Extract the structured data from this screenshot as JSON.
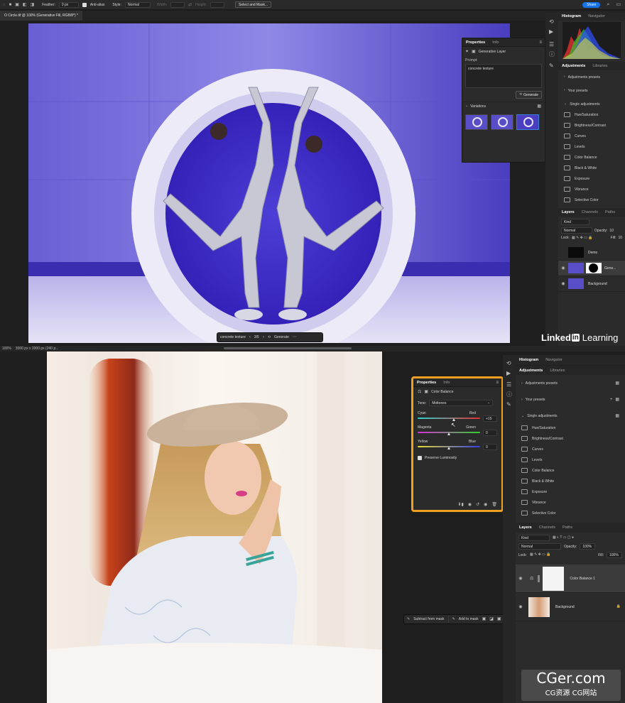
{
  "top": {
    "options_bar": {
      "feather_label": "Feather:",
      "feather_value": "0 px",
      "anti_alias_label": "Anti-alias",
      "style_label": "Style:",
      "style_value": "Normal",
      "width_label": "Width:",
      "height_label": "Height:",
      "select_mask_label": "Select and Mask...",
      "share_label": "Share"
    },
    "doc_tab": "O Circle.tif @ 100% (Generative Fill, RGB/8*) *",
    "properties": {
      "tab_properties": "Properties",
      "tab_info": "Info",
      "layer_type": "Generative Layer",
      "prompt_label": "Prompt:",
      "prompt_value": "concrete texture",
      "generate_label": "Generate",
      "variations_label": "Variations"
    },
    "canvas_bar": {
      "prompt": "concrete texture",
      "counter": "3/5",
      "generate": "Generate"
    },
    "right_panel": {
      "tab_histogram": "Histogram",
      "tab_navigator": "Navigator",
      "tab_adjustments": "Adjustments",
      "tab_libraries": "Libraries",
      "adjustment_presets": "Adjustments presets",
      "your_presets": "Your presets",
      "single_adjustments": "Single adjustments",
      "items": [
        "Hue/Saturation",
        "Brightness/Contrast",
        "Curves",
        "Levels",
        "Color Balance",
        "Black & White",
        "Exposure",
        "Vibrance",
        "Selective Color"
      ],
      "layers_tabs": [
        "Layers",
        "Channels",
        "Paths"
      ],
      "kind_label": "Kind",
      "blend_mode": "Normal",
      "opacity_label": "Opacity:",
      "opacity_value": "10",
      "lock_label": "Lock:",
      "fill_label": "Fill:",
      "fill_value": "10",
      "layers": [
        "Demo",
        "Gene...",
        "Background"
      ]
    },
    "status": "100%",
    "status_dims": "3000 px x 2000 px (240 p...",
    "watermark": "Linked",
    "watermark_in": "in",
    "watermark_learning": "Learning"
  },
  "bottom": {
    "properties": {
      "tab_properties": "Properties",
      "tab_info": "Info",
      "layer_type": "Color Balance",
      "tone_label": "Tone:",
      "tone_value": "Midtones",
      "cyan": "Cyan",
      "red": "Red",
      "cyan_red_value": "+15",
      "magenta": "Magenta",
      "green": "Green",
      "magenta_green_value": "0",
      "yellow": "Yellow",
      "blue": "Blue",
      "yellow_blue_value": "0",
      "preserve_luminosity": "Preserve Luminosity",
      "cyan_red_level": 0.58,
      "magenta_green_level": 0.5,
      "yellow_blue_level": 0.5
    },
    "mask_bar": {
      "subtract": "Subtract from mask",
      "add": "Add to mask"
    },
    "right_panel": {
      "tab_histogram": "Histogram",
      "tab_navigator": "Navigator",
      "tab_adjustments": "Adjustments",
      "tab_libraries": "Libraries",
      "adjustment_presets": "Adjustments presets",
      "your_presets": "Your presets",
      "single_adjustments": "Single adjustments",
      "items": [
        "Hue/Saturation",
        "Brightness/Contrast",
        "Curves",
        "Levels",
        "Color Balance",
        "Black & White",
        "Exposure",
        "Vibrance",
        "Selective Color"
      ],
      "layers_tabs": [
        "Layers",
        "Channels",
        "Paths"
      ],
      "kind_label": "Kind",
      "blend_mode": "Normal",
      "opacity_label": "Opacity:",
      "opacity_value": "100%",
      "lock_label": "Lock:",
      "fill_label": "Fill:",
      "fill_value": "100%",
      "layers": [
        "Color Balance 1",
        "Background"
      ]
    }
  },
  "site_watermark": {
    "main": "CGer.com",
    "sub": "CG资源 CG网站"
  },
  "colors": {
    "highlight": "#f0a020",
    "share_blue": "#1473e6",
    "active_blue": "#3d7bd9"
  }
}
